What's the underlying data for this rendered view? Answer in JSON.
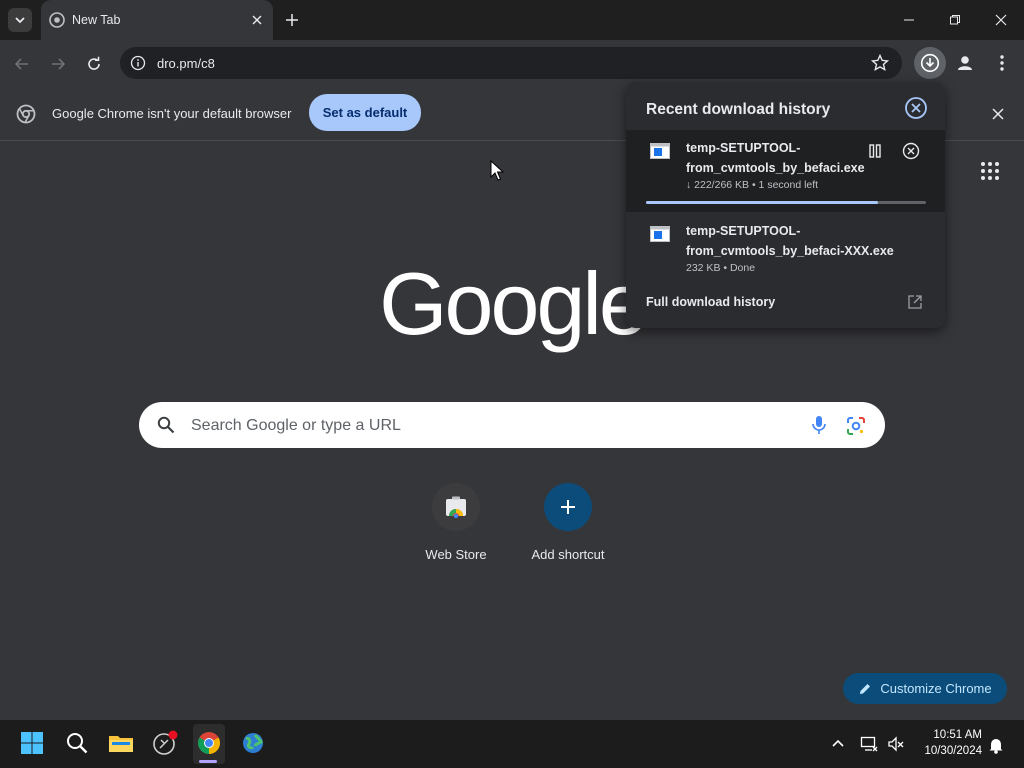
{
  "tab": {
    "title": "New Tab"
  },
  "omnibox": {
    "url": "dro.pm/c8"
  },
  "infobar": {
    "message": "Google Chrome isn't your default browser",
    "button_label": "Set as default"
  },
  "ntp": {
    "search_placeholder": "Search Google or type a URL",
    "shortcuts": [
      {
        "label": "Web Store"
      },
      {
        "label": "Add shortcut"
      }
    ],
    "customize_label": "Customize Chrome"
  },
  "downloads": {
    "title": "Recent download history",
    "items": [
      {
        "name_line1": "temp-SETUPTOOL-",
        "name_line2": "from_cvmtools_by_befaci.exe",
        "status": "↓ 222/266 KB • 1 second left",
        "progress": 0.83
      },
      {
        "name_line1": "temp-SETUPTOOL-",
        "name_line2": "from_cvmtools_by_befaci-XXX.exe",
        "status": "232 KB • Done",
        "progress": 1.0
      }
    ],
    "full_history_label": "Full download history"
  },
  "taskbar": {
    "time": "10:51 AM",
    "date": "10/30/2024"
  },
  "colors": {
    "accent": "#a8c7fa",
    "background": "#35363a",
    "customize_bg": "#0b4c7a"
  }
}
